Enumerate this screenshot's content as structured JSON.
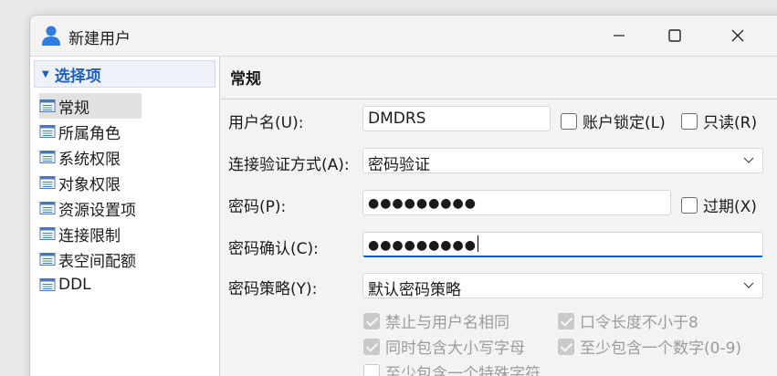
{
  "window": {
    "title": "新建用户"
  },
  "sidebar": {
    "header": "选择项",
    "items": [
      {
        "label": "常规",
        "selected": true
      },
      {
        "label": "所属角色"
      },
      {
        "label": "系统权限"
      },
      {
        "label": "对象权限"
      },
      {
        "label": "资源设置项"
      },
      {
        "label": "连接限制"
      },
      {
        "label": "表空间配额"
      },
      {
        "label": "DDL"
      }
    ]
  },
  "main": {
    "section_title": "常规",
    "username": {
      "label": "用户名(U):",
      "value": "DMDRS"
    },
    "account_lock": {
      "label": "账户锁定(L)",
      "checked": false
    },
    "read_only": {
      "label": "只读(R)",
      "checked": false
    },
    "auth_method": {
      "label": "连接验证方式(A):",
      "value": "密码验证"
    },
    "password": {
      "label": "密码(P):",
      "value": "●●●●●●●●●"
    },
    "expired": {
      "label": "过期(X)",
      "checked": false
    },
    "password_confirm": {
      "label": "密码确认(C):",
      "value": "●●●●●●●●●"
    },
    "policy": {
      "label": "密码策略(Y):",
      "value": "默认密码策略"
    },
    "policy_options": {
      "no_same_as_username": {
        "label": "禁止与用户名相同",
        "checked": true
      },
      "min_length": {
        "label": "口令长度不小于8",
        "checked": true
      },
      "mixed_case": {
        "label": "同时包含大小写字母",
        "checked": true
      },
      "has_digit": {
        "label": "至少包含一个数字(0-9)",
        "checked": true
      },
      "has_special": {
        "label": "至少包含一个特殊字符",
        "checked": false
      }
    }
  },
  "colors": {
    "accent": "#0a5fc4",
    "header_text": "#1f5fbf"
  }
}
